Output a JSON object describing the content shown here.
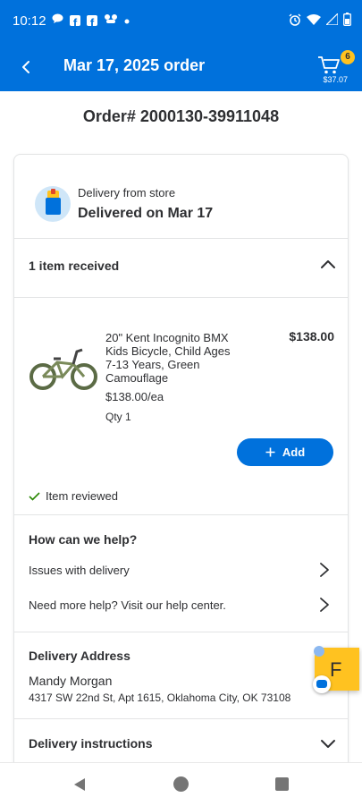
{
  "status_bar": {
    "time": "10:12",
    "battery": "",
    "icons_left": [
      "chat-icon",
      "facebook-icon",
      "facebook-icon",
      "games-icon",
      "dot-icon"
    ],
    "icons_right": [
      "alarm-icon",
      "wifi-icon",
      "signal-icon",
      "battery-icon"
    ]
  },
  "header": {
    "title": "Mar 17, 2025 order",
    "cart_count": "6",
    "cart_total": "$37.07",
    "bg_color": "#0071dc"
  },
  "order": {
    "number": "Order# 2000130-39911048"
  },
  "delivery": {
    "subtitle": "Delivery from store",
    "status": "Delivered on Mar 17"
  },
  "items_section": {
    "title": "1 item received"
  },
  "product": {
    "name": "20\" Kent Incognito BMX Kids Bicycle, Child Ages 7-13 Years, Green Camouflage",
    "price": "$138.00",
    "unit_price": "$138.00/ea",
    "qty": "Qty 1",
    "add_label": "Add",
    "reviewed_label": "Item reviewed"
  },
  "help": {
    "title": "How can we help?",
    "rows": [
      {
        "label": "Issues with delivery"
      },
      {
        "label": "Need more help? Visit our help center."
      }
    ]
  },
  "address": {
    "title": "Delivery Address",
    "name": "Mandy Morgan",
    "line": "4317 SW 22nd St, Apt 1615, Oklahoma City, OK 73108"
  },
  "instructions": {
    "title": "Delivery instructions"
  },
  "floating": {
    "letter": "F"
  }
}
